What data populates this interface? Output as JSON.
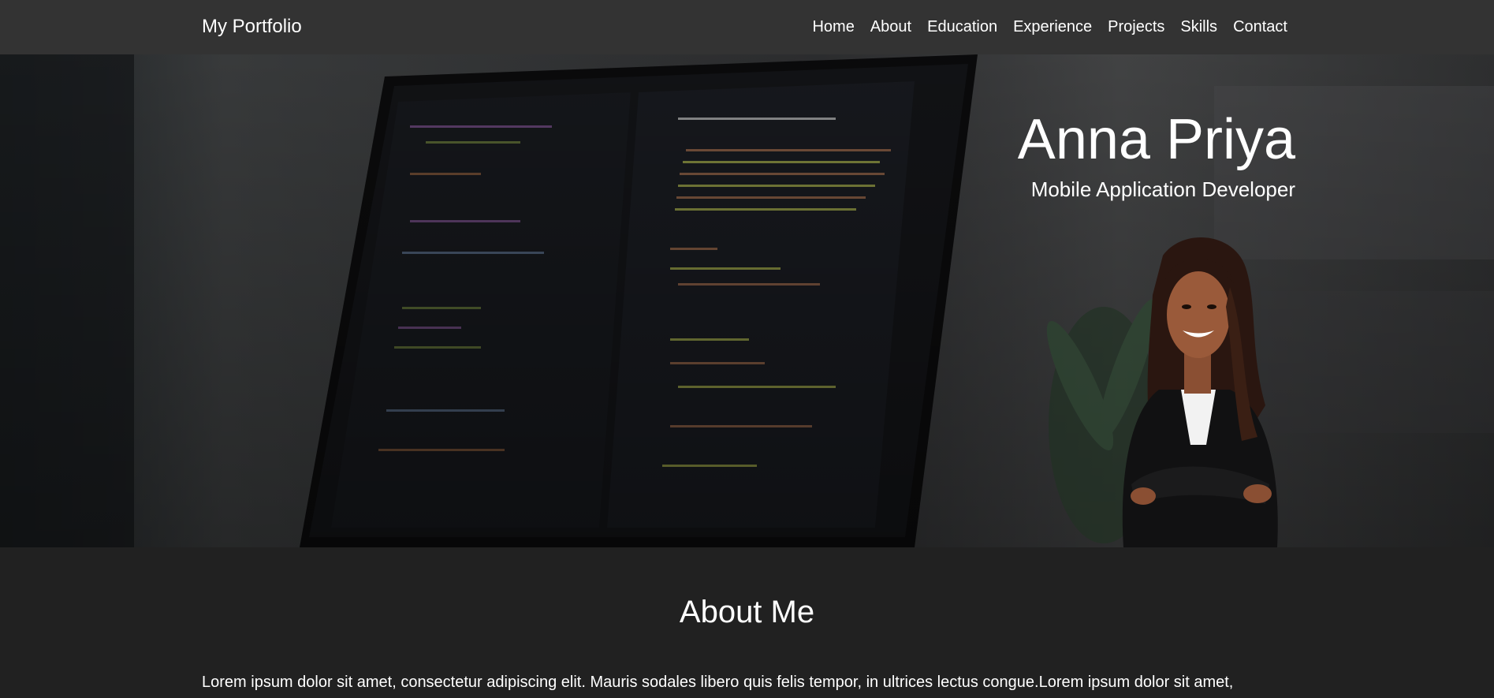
{
  "navbar": {
    "brand": "My Portfolio",
    "links": [
      "Home",
      "About",
      "Education",
      "Experience",
      "Projects",
      "Skills",
      "Contact"
    ]
  },
  "hero": {
    "name": "Anna Priya",
    "role": "Mobile Application Developer",
    "background_image": "laptop-code-editor-photo",
    "portrait_image": "developer-portrait-photo"
  },
  "about": {
    "heading": "About Me",
    "text": "Lorem ipsum dolor sit amet, consectetur adipiscing elit. Mauris sodales libero quis felis tempor, in ultrices lectus congue.Lorem ipsum dolor sit amet,"
  },
  "colors": {
    "navbar_bg": "#333333",
    "page_bg": "#212121",
    "text": "#ffffff"
  }
}
